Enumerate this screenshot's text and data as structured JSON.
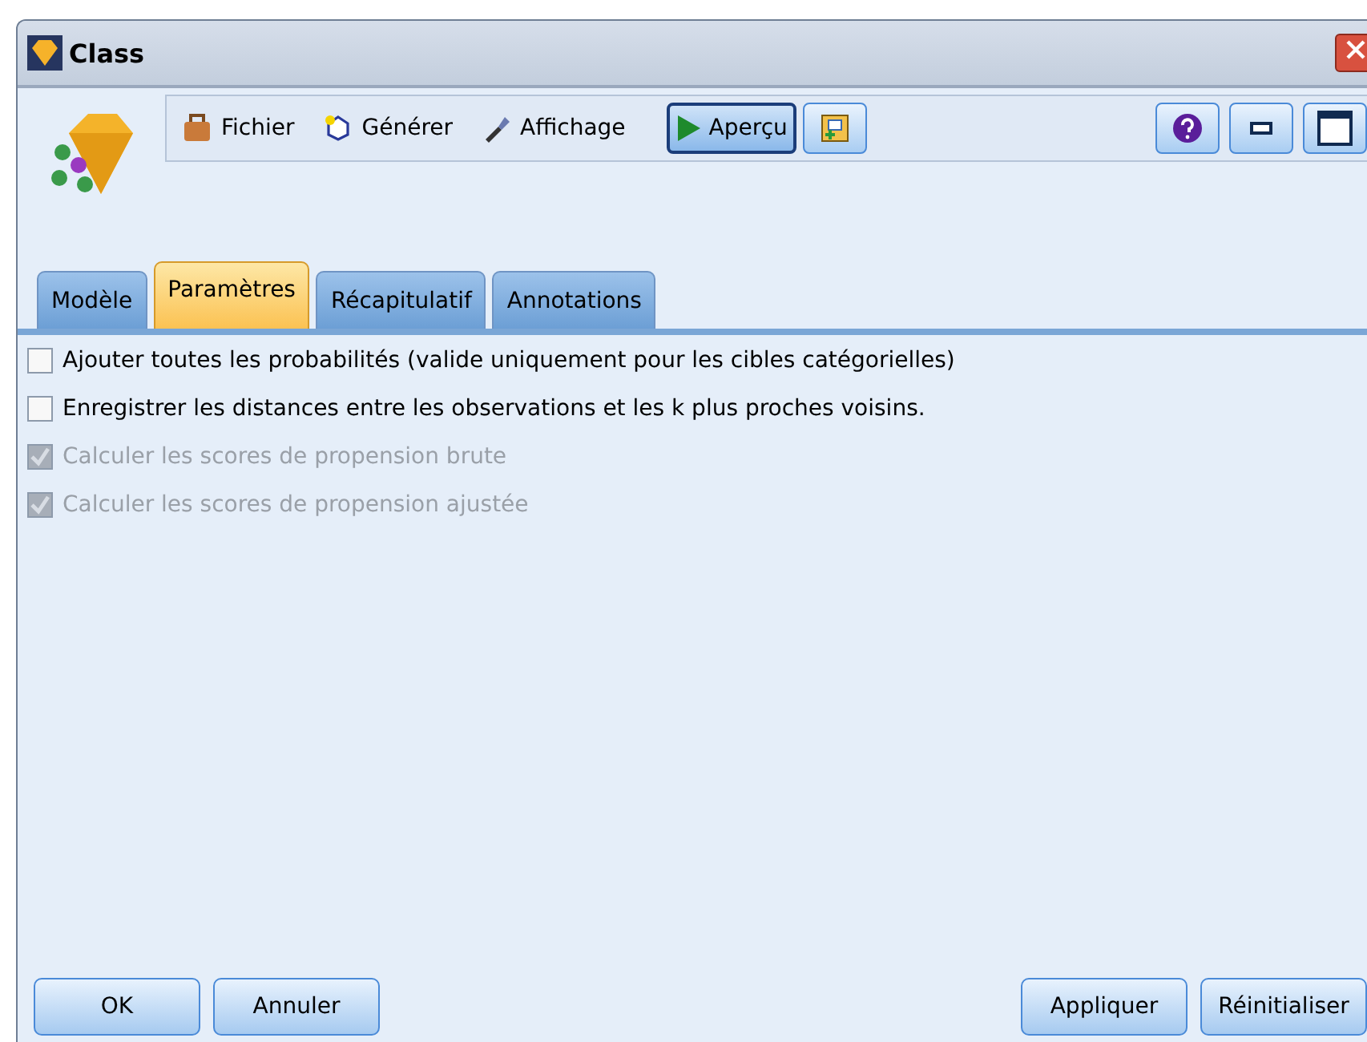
{
  "window": {
    "title": "Class"
  },
  "toolbar": {
    "menus": [
      {
        "label": "Fichier"
      },
      {
        "label": "Générer"
      },
      {
        "label": "Affichage"
      }
    ],
    "preview": {
      "label": "Aperçu",
      "selected": true
    }
  },
  "tabs": [
    {
      "label": "Modèle",
      "selected": false
    },
    {
      "label": "Paramètres",
      "selected": true
    },
    {
      "label": "Récapitulatif",
      "selected": false
    },
    {
      "label": "Annotations",
      "selected": false
    }
  ],
  "options": [
    {
      "label": "Ajouter toutes les probabilités (valide uniquement pour les cibles catégorielles)",
      "checked": false,
      "disabled": false
    },
    {
      "label": "Enregistrer les distances entre les observations et les k plus proches voisins.",
      "checked": false,
      "disabled": false
    },
    {
      "label": "Calculer les scores de propension brute",
      "checked": true,
      "disabled": true
    },
    {
      "label": "Calculer les scores de propension ajustée",
      "checked": true,
      "disabled": true
    }
  ],
  "buttons_left": [
    "OK",
    "Annuler"
  ],
  "buttons_right": [
    "Appliquer",
    "Réinitialiser"
  ]
}
